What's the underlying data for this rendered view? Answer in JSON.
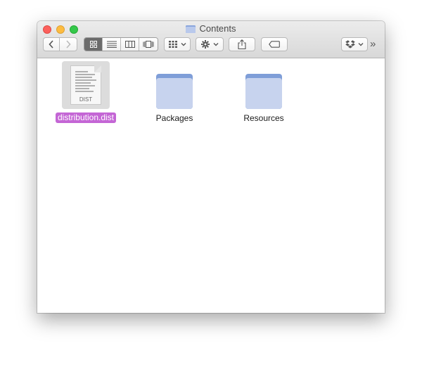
{
  "window": {
    "title": "Contents"
  },
  "toolbar": {
    "view_modes": [
      "icon-view",
      "list-view",
      "column-view",
      "cover-flow-view"
    ],
    "active_view": "icon-view",
    "overflow_label": "»"
  },
  "files": [
    {
      "name": "distribution.dist",
      "kind": "document",
      "badge": "DIST",
      "selected": true
    },
    {
      "name": "Packages",
      "kind": "folder",
      "selected": false
    },
    {
      "name": "Resources",
      "kind": "folder",
      "selected": false
    }
  ],
  "colors": {
    "folder_body": "#c7d3ee",
    "folder_tab": "#7f9ed8",
    "selection": "#c466d5",
    "active_segment": "#6b6b6b"
  }
}
